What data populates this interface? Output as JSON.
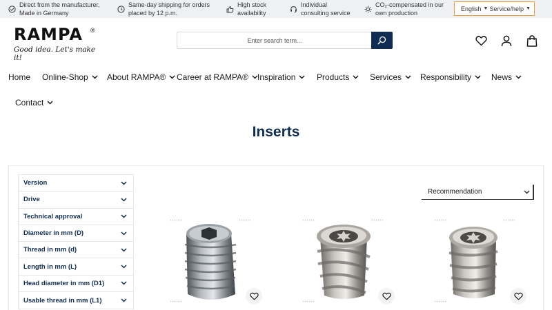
{
  "topbar": {
    "usps": [
      {
        "icon": "check-circle-icon",
        "text": "Direct from the manufacturer, Made in Germany"
      },
      {
        "icon": "clock-icon",
        "text": "Same-day shipping for orders placed by 12 p.m."
      },
      {
        "icon": "thumbs-up-icon",
        "text": "High stock availability"
      },
      {
        "icon": "headset-icon",
        "text": "Individual consulting service"
      },
      {
        "icon": "sun-icon",
        "text": "CO₂-compensated in our own production"
      }
    ],
    "language": "English",
    "service": "Service/help"
  },
  "header": {
    "logo_text": "RAMPA",
    "logo_reg": "®",
    "tagline": "Good idea. Let's make it!",
    "search_placeholder": "Enter search term..."
  },
  "nav": [
    "Home",
    "Online-Shop",
    "About RAMPA®",
    "Career at RAMPA®",
    "Inspiration",
    "Products",
    "Services",
    "Responsibility",
    "News",
    "Contact"
  ],
  "page": {
    "title": "Inserts"
  },
  "filters": [
    "Version",
    "Drive",
    "Technical approval",
    "Diameter in mm (D)",
    "Thread in mm (d)",
    "Length in mm (L)",
    "Head diameter in mm (D1)",
    "Usable thread in mm (L1)"
  ],
  "sort": {
    "selected": "Recommendation"
  },
  "colors": {
    "brand_navy": "#0f2c52",
    "topbar_bg": "#eef0f3",
    "lang_border": "#e8a33d"
  }
}
